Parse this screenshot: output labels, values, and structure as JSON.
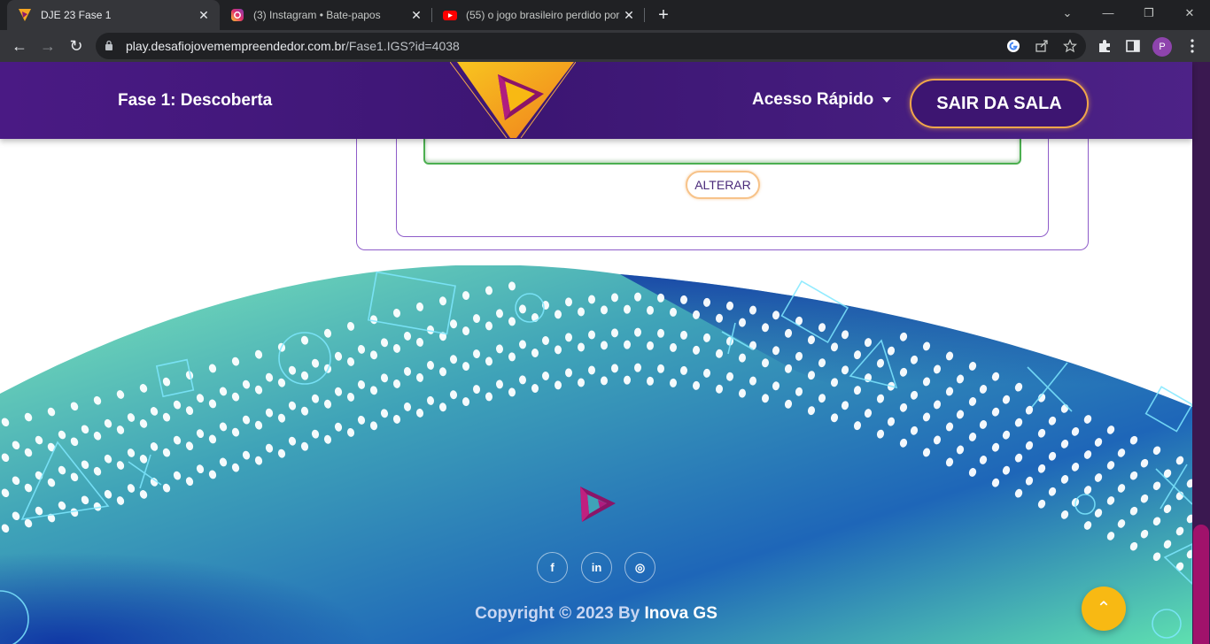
{
  "browser": {
    "tabs": [
      {
        "title": "DJE 23 Fase 1",
        "active": true,
        "icon": "dje-logo-icon"
      },
      {
        "title": "(3) Instagram • Bate-papos",
        "active": false,
        "icon": "instagram-icon"
      },
      {
        "title": "(55) o jogo brasileiro perdido por",
        "active": false,
        "icon": "youtube-icon"
      }
    ],
    "new_tab": "+",
    "url_host": "play.desafiojovemempreendedor.com.br",
    "url_path": "/Fase1.IGS?id=4038",
    "profile_initial": "P"
  },
  "header": {
    "phase_title": "Fase 1: Descoberta",
    "quick_access": "Acesso Rápido",
    "leave_button": "SAIR DA SALA"
  },
  "content": {
    "alter_button": "ALTERAR"
  },
  "footer": {
    "social": [
      {
        "label": "f",
        "icon": "facebook-icon"
      },
      {
        "label": "in",
        "icon": "linkedin-icon"
      },
      {
        "label": "◎",
        "icon": "instagram-icon"
      }
    ],
    "copyright_prefix": "Copyright © 2023 By",
    "copyright_brand": "Inova GS",
    "to_top": "⌃"
  },
  "colors": {
    "header_purple": "#4a1a84",
    "accent_orange": "#f0a64a",
    "to_top_yellow": "#f8b913",
    "footer_teal": "#3fa3b8",
    "footer_blue": "#0d3aa6"
  }
}
